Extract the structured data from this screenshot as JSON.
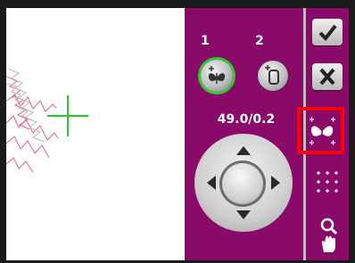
{
  "designs": [
    {
      "number": "1",
      "icon": "butterfly-move-icon",
      "active": true
    },
    {
      "number": "2",
      "icon": "hoop-position-icon",
      "active": false
    }
  ],
  "position_readout": "49.0/0.2",
  "right_tools": [
    "ok-check-icon",
    "close-x-icon",
    "butterfly-icon",
    "center-grid-icon",
    "zoom-pan-icon"
  ],
  "colors": {
    "panel": "#8a0a69",
    "highlight": "#ff0000",
    "active_ring": "#2fcc2f"
  }
}
